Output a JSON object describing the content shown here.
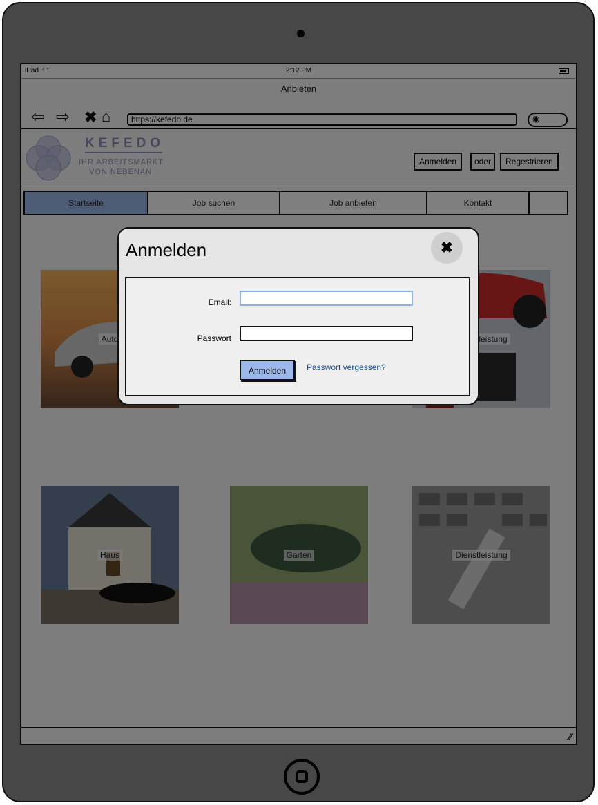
{
  "device": {
    "status": {
      "carrier": "iPad",
      "time": "2:12 PM"
    },
    "browser": {
      "title": "Anbieten",
      "url": "https://kefedo.de"
    }
  },
  "site": {
    "logo": {
      "title": "KEFEDO",
      "subtitle_line1": "IHR ARBEITSMARKT",
      "subtitle_line2": "VON NEBENAN"
    },
    "auth": {
      "login_label": "Anmelden",
      "or_label": "oder",
      "register_label": "Regestrieren"
    },
    "nav": {
      "tabs": [
        {
          "label": "Startseite",
          "active": true
        },
        {
          "label": "Job suchen"
        },
        {
          "label": "Job anbieten"
        },
        {
          "label": "Kontakt"
        },
        {
          "label": ""
        }
      ]
    },
    "tiles": [
      {
        "label": "Auto"
      },
      {
        "label": "Dienstleistung"
      },
      {
        "label": "Haus"
      },
      {
        "label": "Garten"
      },
      {
        "label": "Dienstleistung"
      }
    ]
  },
  "modal": {
    "title": "Anmelden",
    "email_label": "Email:",
    "password_label": "Passwort",
    "email_value": "",
    "password_value": "",
    "submit_label": "Anmelden",
    "forgot_label": "Passwort vergessen?"
  },
  "colors": {
    "accent": "#9cb8ea",
    "link": "#1f4e96",
    "overlay": "rgba(0,0,0,0.5)"
  }
}
